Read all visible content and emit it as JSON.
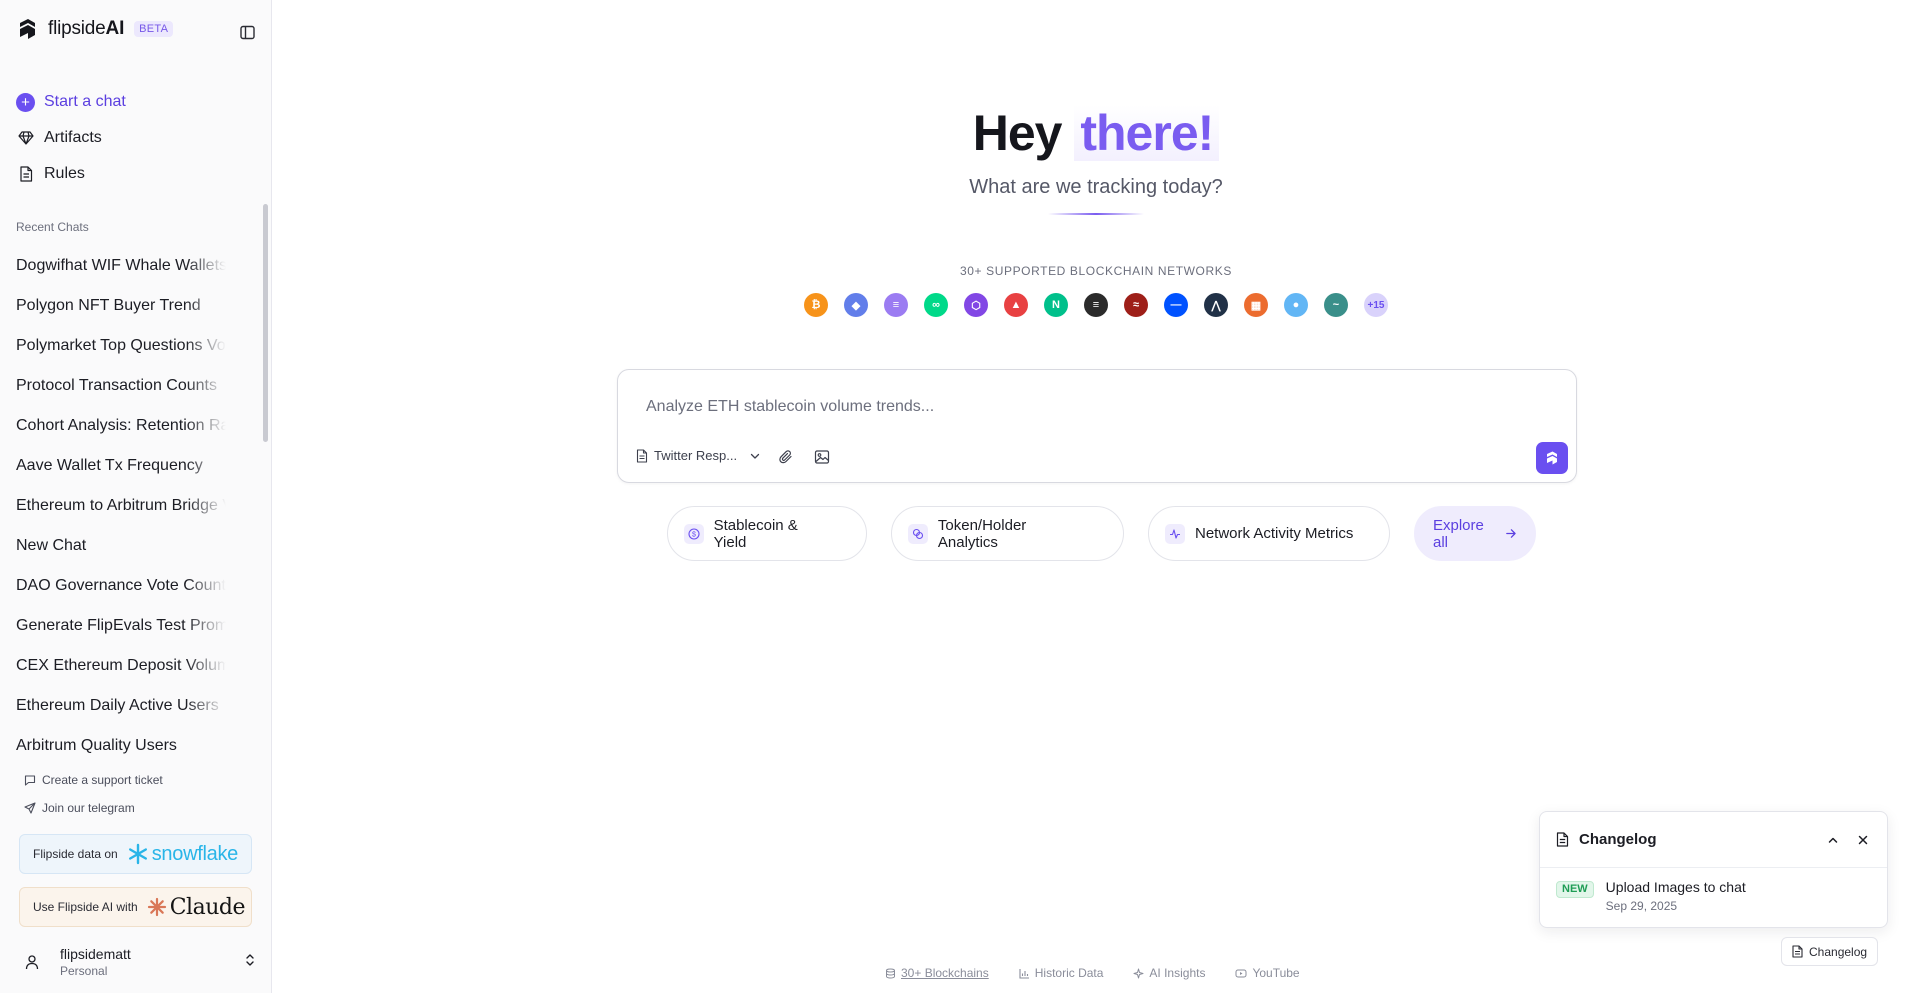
{
  "brand": {
    "name_plain": "flipside",
    "name_bold": "AI",
    "badge": "BETA"
  },
  "nav": {
    "start_chat": "Start a chat",
    "artifacts": "Artifacts",
    "rules": "Rules"
  },
  "recent": {
    "label": "Recent Chats",
    "items": [
      "Dogwifhat WIF Whale Wallets",
      "Polygon NFT Buyer Trend",
      "Polymarket Top Questions Volume",
      "Protocol Transaction Counts",
      "Cohort Analysis: Retention Rates",
      "Aave Wallet Tx Frequency",
      "Ethereum to Arbitrum Bridge Volume",
      "New Chat",
      "DAO Governance Vote Counts",
      "Generate FlipEvals Test Prompts",
      "CEX Ethereum Deposit Volume",
      "Ethereum Daily Active Users",
      "Arbitrum Quality Users"
    ]
  },
  "support": {
    "ticket": "Create a support ticket",
    "telegram": "Join our telegram"
  },
  "promos": {
    "snowflake_text": "Flipside data on",
    "snowflake_word": "snowflake",
    "claude_text": "Use Flipside AI with",
    "claude_word": "Claude"
  },
  "user": {
    "name": "flipsidematt",
    "workspace": "Personal"
  },
  "hero": {
    "greeting": "Hey",
    "accent": "there!",
    "subtitle": "What are we tracking today?"
  },
  "chains": {
    "label": "30+ SUPPORTED BLOCKCHAIN NETWORKS",
    "icons": [
      {
        "name": "bitcoin-icon",
        "color": "#f7931a",
        "glyph": "₿"
      },
      {
        "name": "ethereum-icon",
        "color": "#627eea",
        "glyph": "◆"
      },
      {
        "name": "solana-icon",
        "color": "#9b7cf2",
        "glyph": "≡"
      },
      {
        "name": "flow-icon",
        "color": "#00d989",
        "glyph": "∞"
      },
      {
        "name": "polygon-icon",
        "color": "#8247e5",
        "glyph": "⬡"
      },
      {
        "name": "avalanche-icon",
        "color": "#e84142",
        "glyph": "▲"
      },
      {
        "name": "near-icon",
        "color": "#00c08b",
        "glyph": "N"
      },
      {
        "name": "aptos-icon",
        "color": "#2b2b2b",
        "glyph": "≡"
      },
      {
        "name": "sei-icon",
        "color": "#9e1f19",
        "glyph": "≈"
      },
      {
        "name": "base-icon",
        "color": "#0052ff",
        "glyph": "—"
      },
      {
        "name": "arbitrum-icon",
        "color": "#213147",
        "glyph": "⋀"
      },
      {
        "name": "blast-icon",
        "color": "#ec6c2f",
        "glyph": "▦"
      },
      {
        "name": "osmosis-icon",
        "color": "#62b6f5",
        "glyph": "●"
      },
      {
        "name": "sui-icon",
        "color": "#3a8f8a",
        "glyph": "~"
      },
      {
        "name": "more-chains-badge",
        "color": "#d9d2fb",
        "glyph": "+15"
      }
    ]
  },
  "composer": {
    "placeholder": "Analyze ETH stablecoin volume trends...",
    "value": "",
    "tool_label": "Twitter Resp..."
  },
  "chips": {
    "stablecoin": "Stablecoin & Yield",
    "token": "Token/Holder Analytics",
    "network": "Network Activity Metrics",
    "explore": "Explore all"
  },
  "footer": {
    "blockchains": "30+ Blockchains",
    "historic": "Historic Data",
    "insights": "AI Insights",
    "youtube": "YouTube"
  },
  "changelog": {
    "title": "Changelog",
    "badge": "NEW",
    "item_title": "Upload Images to chat",
    "item_date": "Sep 29, 2025",
    "toggle_label": "Changelog"
  },
  "colors": {
    "accent": "#6a4ff0",
    "accent_text": "#7a5cf0",
    "new_badge": "#1f9d55"
  }
}
